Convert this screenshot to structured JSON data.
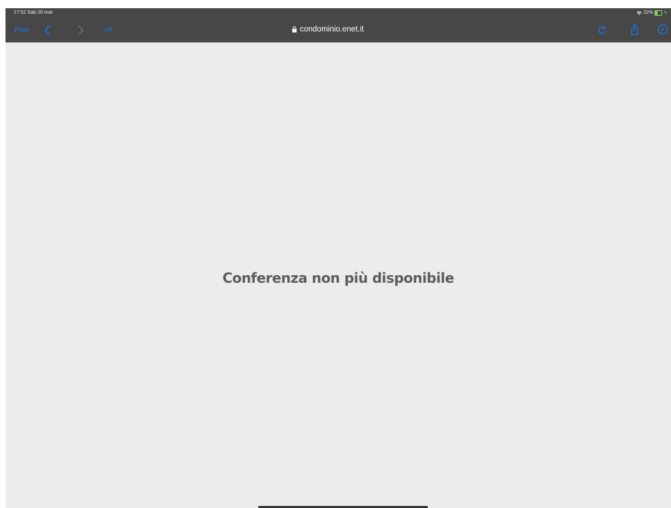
{
  "status_bar": {
    "time_date": "17:52  Sab 20 mar",
    "battery_percent": "22%"
  },
  "toolbar": {
    "done_label": "Fine",
    "text_size_label_small": "A",
    "text_size_label_large": "A",
    "url": "condominio.enet.it",
    "icons": [
      "back-chevron-icon",
      "forward-chevron-icon",
      "lock-icon",
      "reload-icon",
      "share-icon",
      "compass-icon"
    ]
  },
  "main": {
    "message": "Conferenza non più disponibile"
  },
  "colors": {
    "toolbar_bg": "#474747",
    "page_bg": "#ececec",
    "accent": "#1a73e8",
    "message_text": "#5c5c5c"
  }
}
